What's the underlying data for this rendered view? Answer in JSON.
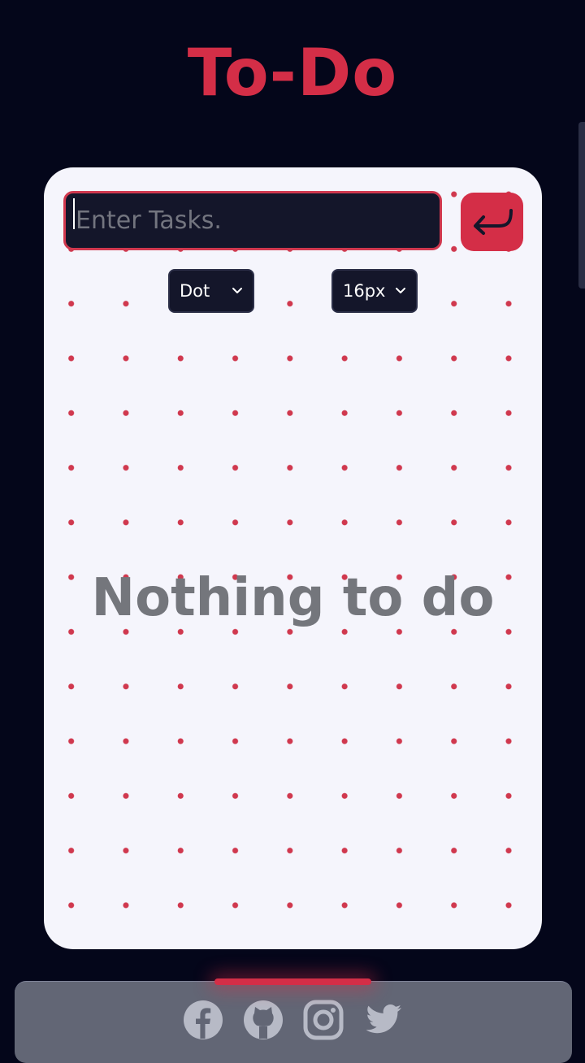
{
  "header": {
    "title": "To-Do"
  },
  "task_form": {
    "input_placeholder": "Enter Tasks.",
    "input_value": "",
    "submit_icon": "enter-return-icon"
  },
  "controls": {
    "style_select": {
      "selected": "Dot"
    },
    "size_select": {
      "selected": "16px"
    }
  },
  "task_list": {
    "empty_message": "Nothing to do"
  },
  "footer": {
    "social_icons": [
      "facebook-icon",
      "github-icon",
      "instagram-icon",
      "twitter-icon"
    ]
  },
  "colors": {
    "background": "#04061a",
    "accent": "#d42e47",
    "card": "#f5f5fc",
    "input_background": "#14162a",
    "muted_text": "#74767c",
    "footer": "#626675"
  }
}
